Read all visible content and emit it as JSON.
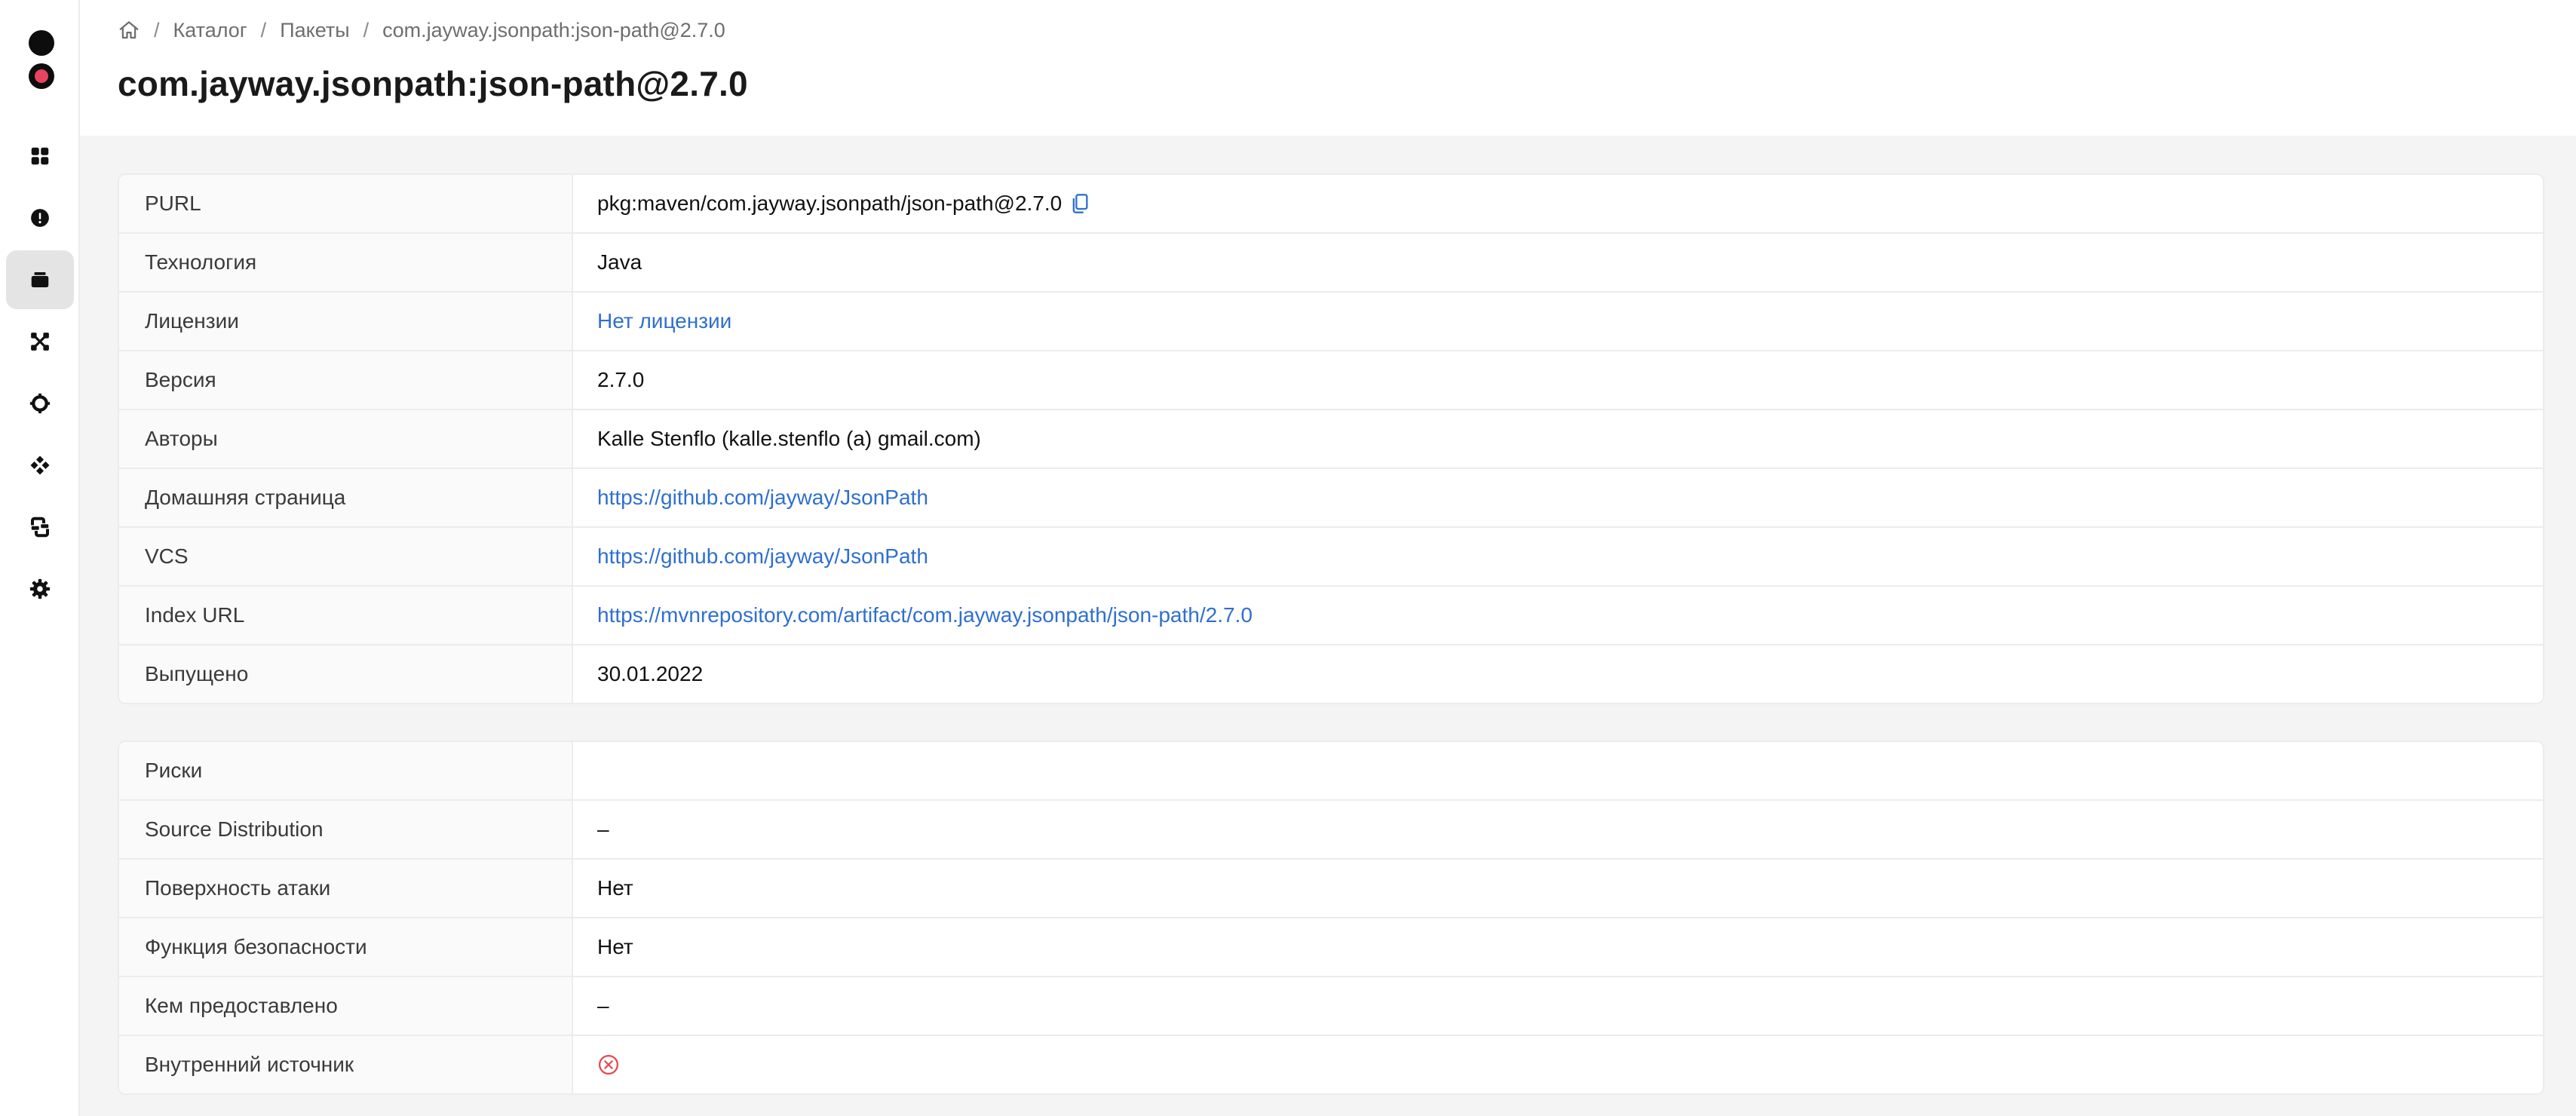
{
  "breadcrumb": {
    "items": [
      "Каталог",
      "Пакеты",
      "com.jayway.jsonpath:json-path@2.7.0"
    ]
  },
  "page": {
    "title": "com.jayway.jsonpath:json-path@2.7.0"
  },
  "sidebar": {
    "icons": [
      "dashboard-icon",
      "alert-icon",
      "packages-icon",
      "graph-icon",
      "component-icon",
      "puzzle-icon",
      "integration-icon",
      "settings-icon"
    ],
    "active": "packages-icon"
  },
  "details": {
    "rows": [
      {
        "label": "PURL",
        "value": "pkg:maven/com.jayway.jsonpath/json-path@2.7.0"
      },
      {
        "label": "Технология",
        "value": "Java"
      },
      {
        "label": "Лицензии",
        "value": "Нет лицензии"
      },
      {
        "label": "Версия",
        "value": "2.7.0"
      },
      {
        "label": "Авторы",
        "value": "Kalle Stenflo (kalle.stenflo (a) gmail.com)"
      },
      {
        "label": "Домашняя страница",
        "value": "https://github.com/jayway/JsonPath"
      },
      {
        "label": "VCS",
        "value": "https://github.com/jayway/JsonPath"
      },
      {
        "label": "Index URL",
        "value": "https://mvnrepository.com/artifact/com.jayway.jsonpath/json-path/2.7.0"
      },
      {
        "label": "Выпущено",
        "value": "30.01.2022"
      }
    ]
  },
  "risks": {
    "rows": [
      {
        "label": "Риски",
        "value": ""
      },
      {
        "label": "Source Distribution",
        "value": "–"
      },
      {
        "label": "Поверхность атаки",
        "value": "Нет"
      },
      {
        "label": "Функция безопасности",
        "value": "Нет"
      },
      {
        "label": "Кем предоставлено",
        "value": "–"
      },
      {
        "label": "Внутренний источник",
        "value": ""
      }
    ]
  },
  "colors": {
    "link": "#2f6fd0",
    "error": "#e5484d",
    "logo_accent": "#e8435f"
  }
}
